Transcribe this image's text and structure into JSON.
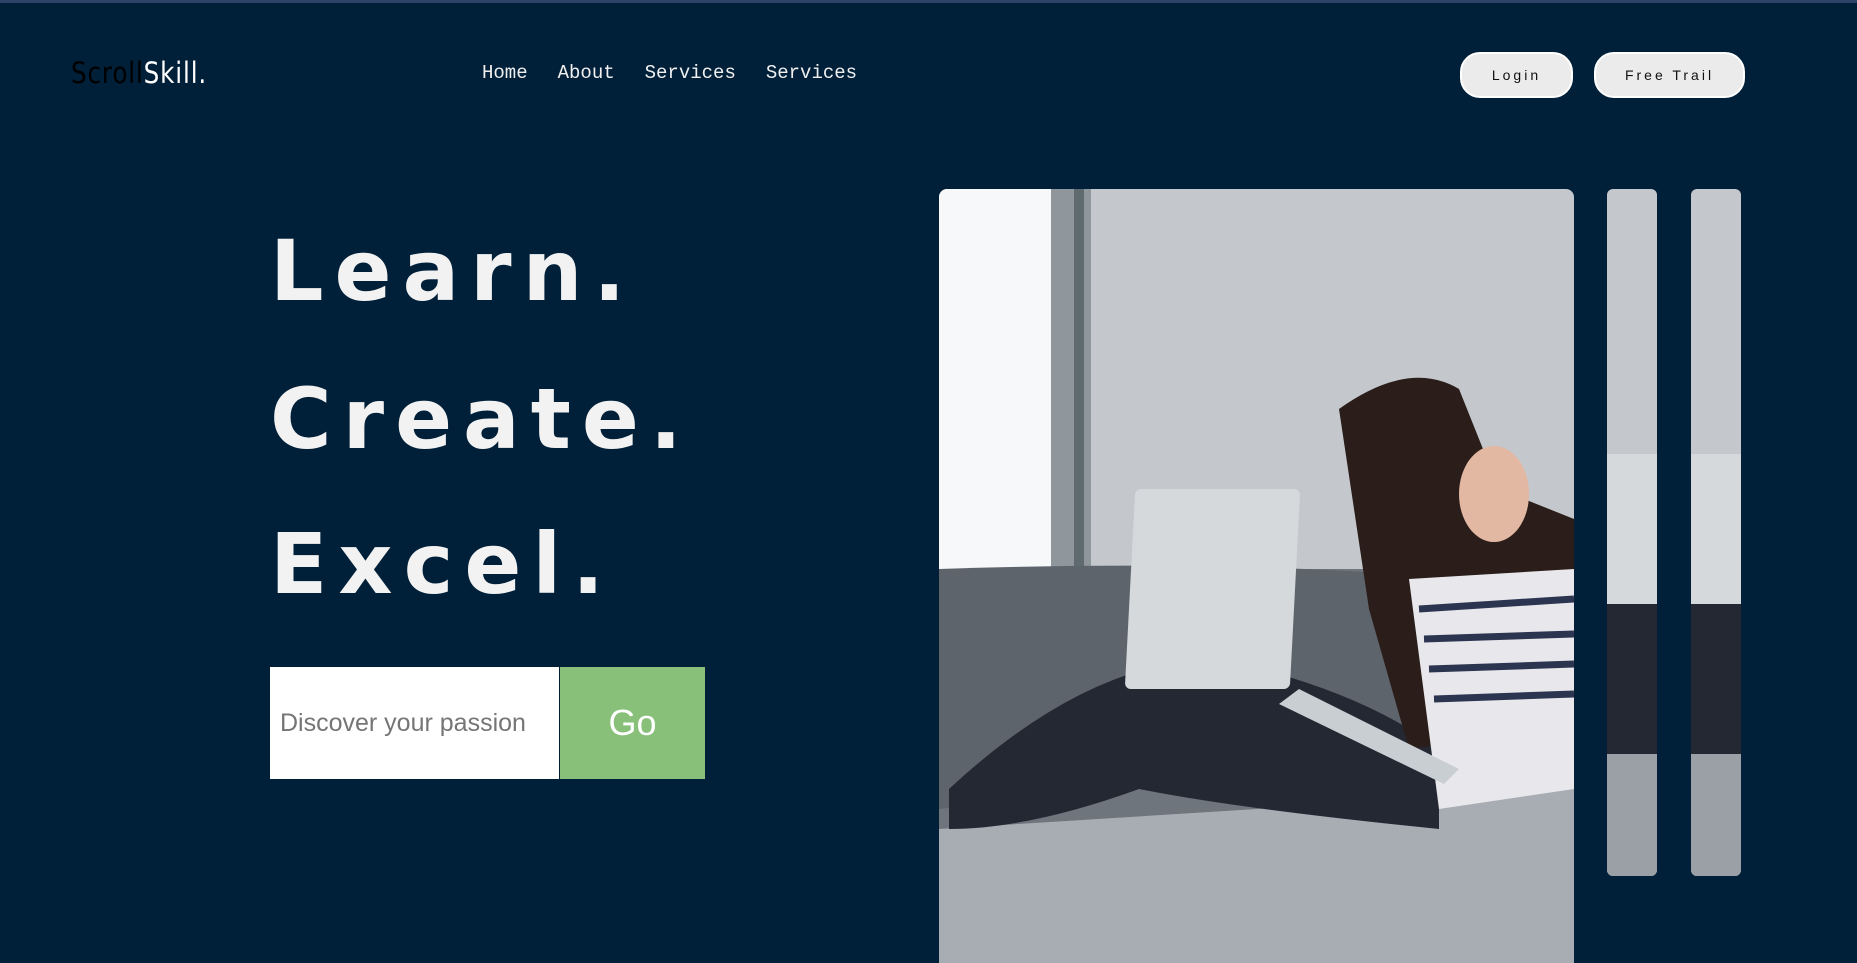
{
  "brand": {
    "part1": "Scroll",
    "part2": "Skill."
  },
  "nav": [
    "Home",
    "About",
    "Services",
    "Services"
  ],
  "buttons": {
    "login": "Login",
    "free_trial": "Free Trail"
  },
  "hero": {
    "lines": [
      "Learn.",
      "Create.",
      "Excel."
    ]
  },
  "search": {
    "placeholder": "Discover your passion",
    "go": "Go"
  },
  "colors": {
    "background": "#001f38",
    "go": "#88c07a"
  }
}
